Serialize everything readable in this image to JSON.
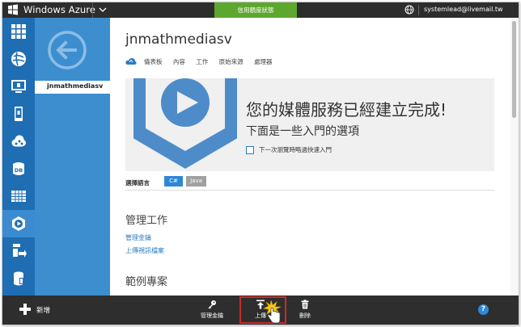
{
  "topbar": {
    "brand": "Windows Azure",
    "credit_status": "信用額度狀態",
    "user_email": "systemlead@livemail.tw"
  },
  "leftbar": {
    "items": [
      {
        "icon": "grid-icon",
        "name": "all-items"
      },
      {
        "icon": "web-sites-icon",
        "name": "web-sites"
      },
      {
        "icon": "virtual-machines-icon",
        "name": "virtual-machines"
      },
      {
        "icon": "mobile-services-icon",
        "name": "mobile-services"
      },
      {
        "icon": "cloud-services-icon",
        "name": "cloud-services"
      },
      {
        "icon": "sql-database-icon",
        "name": "sql-databases"
      },
      {
        "icon": "storage-icon",
        "name": "storage"
      },
      {
        "icon": "media-services-icon",
        "name": "media-services"
      },
      {
        "icon": "service-bus-icon",
        "name": "service-bus"
      },
      {
        "icon": "data-icon",
        "name": "data"
      }
    ],
    "active_index": 7
  },
  "subpanel": {
    "selected_item": "jnmathmediasv"
  },
  "main": {
    "title": "jnmathmediasv",
    "tabs": [
      "儀表板",
      "內容",
      "工作",
      "原始來源",
      "處理器"
    ],
    "banner": {
      "heading": "您的媒體服務已經建立完成!",
      "subheading": "下面是一些入門的選項",
      "checkbox_label": "下一次瀏覽時略過快速入門"
    },
    "language": {
      "label": "選擇語言",
      "options": [
        "C#",
        "Java"
      ],
      "selected": "C#"
    },
    "section_manage": "管理工作",
    "links": [
      "管理金鑰",
      "上傳視訊檔案"
    ],
    "section_samples": "範例專案"
  },
  "bottombar": {
    "new_label": "新增",
    "commands": [
      {
        "label": "管理金鑰",
        "icon": "key-icon"
      },
      {
        "label": "上傳",
        "icon": "upload-icon"
      },
      {
        "label": "刪除",
        "icon": "trash-icon"
      }
    ],
    "help": "?"
  },
  "colors": {
    "topbar": "#2d2d2d",
    "credit_green": "#5ea72f",
    "leftbar_blue": "#1f6db2",
    "subpanel_blue": "#3d8ecf",
    "media_blue": "#4d8cc9",
    "bottombar": "#2e2e2e",
    "highlight_red": "#c92b2b"
  }
}
